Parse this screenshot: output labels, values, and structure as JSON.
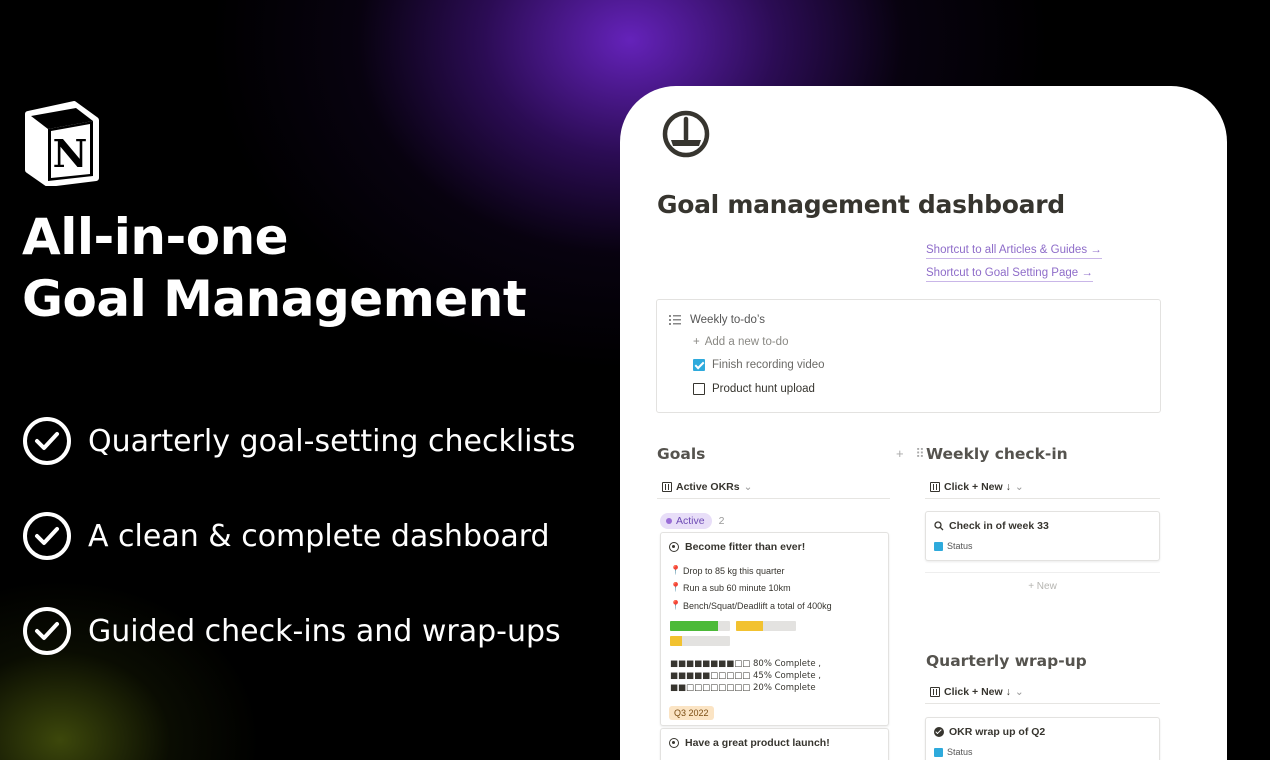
{
  "hero": {
    "headline_line1": "All-in-one",
    "headline_line2": "Goal Management",
    "features": [
      "Quarterly goal-setting checklists",
      "A clean & complete dashboard",
      "Guided check-ins and wrap-ups"
    ]
  },
  "colors": {
    "background": "#000000",
    "glow_purple": "#6a24c4",
    "link_purple": "#8e6cc9",
    "progress_green": "#4cba38",
    "progress_yellow": "#f2c230"
  },
  "dashboard": {
    "title": "Goal management dashboard",
    "shortcuts": [
      "Shortcut to all Articles & Guides →",
      "Shortcut to Goal Setting Page →"
    ],
    "weekly_todos": {
      "title": "Weekly to-do’s",
      "add_label": "Add a new to-do",
      "items": [
        {
          "label": "Finish recording video",
          "checked": true
        },
        {
          "label": "Product hunt upload",
          "checked": false
        }
      ]
    },
    "goals": {
      "title": "Goals",
      "view_label": "Active OKRs",
      "group_label": "Active",
      "group_count": "2",
      "cards": [
        {
          "title": "Become fitter than ever!",
          "key_results": [
            "Drop to 85 kg this quarter",
            "Run a sub 60 minute 10km",
            "Bench/Squat/Deadlift a total of 400kg"
          ],
          "bar_progress": [
            0.8,
            0.45,
            0.2
          ],
          "progress_lines": [
            "■■■■■■■■□□ 80% Complete ,",
            "■■■■■□□□□□ 45% Complete ,",
            "■■□□□□□□□□ 20% Complete"
          ],
          "tag": "Q3 2022"
        },
        {
          "title": "Have a great product launch!"
        }
      ]
    },
    "weekly_checkin": {
      "title": "Weekly check-in",
      "view_label": "Click + New ↓",
      "card_title": "Check in of week 33",
      "card_status": "Status",
      "new_label": "+ New"
    },
    "quarterly_wrapup": {
      "title": "Quarterly wrap-up",
      "view_label": "Click + New ↓",
      "card_title": "OKR wrap up of Q2",
      "card_status": "Status"
    }
  }
}
